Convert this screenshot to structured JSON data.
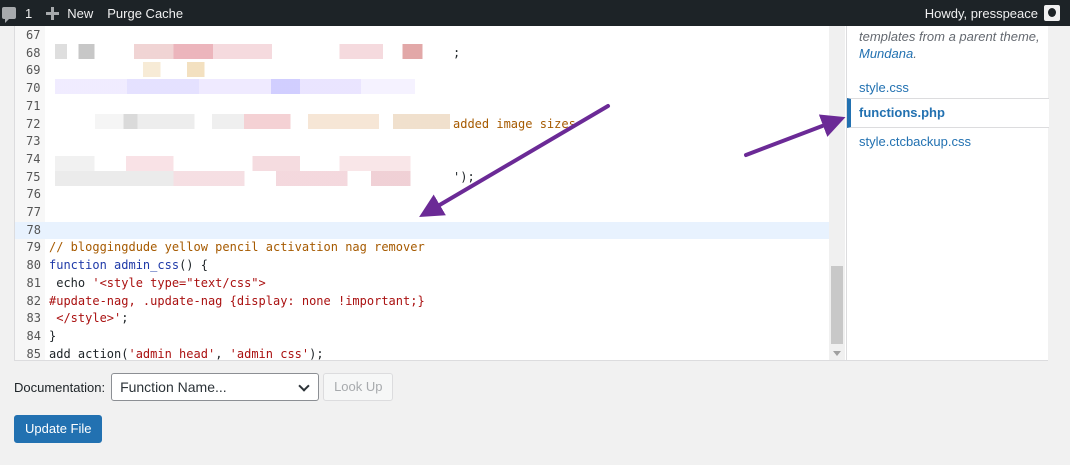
{
  "adminbar": {
    "comment_count": "1",
    "new_label": "New",
    "purge_label": "Purge Cache",
    "greeting": "Howdy, presspeace"
  },
  "editor": {
    "lines": [
      {
        "num": "67",
        "clipped": true,
        "parts": []
      },
      {
        "num": "68",
        "clipped": true,
        "parts": [
          {
            "cls": "c-text",
            "t": ";"
          }
        ]
      },
      {
        "num": "69",
        "clipped": true,
        "parts": []
      },
      {
        "num": "70",
        "clipped": true,
        "parts": []
      },
      {
        "num": "71",
        "clipped": true,
        "parts": []
      },
      {
        "num": "72",
        "clipped": true,
        "parts": [
          {
            "cls": "c-orange",
            "t": "added image sizes"
          }
        ]
      },
      {
        "num": "73",
        "clipped": true,
        "parts": []
      },
      {
        "num": "74",
        "clipped": true,
        "parts": []
      },
      {
        "num": "75",
        "clipped": true,
        "parts": [
          {
            "cls": "c-text",
            "t": "');"
          }
        ]
      },
      {
        "num": "76",
        "clipped": false,
        "parts": []
      },
      {
        "num": "77",
        "clipped": false,
        "parts": []
      },
      {
        "num": "78",
        "clipped": false,
        "parts": []
      },
      {
        "num": "79",
        "clipped": false,
        "parts": [
          {
            "cls": "c-comment",
            "t": "// bloggingdude yellow pencil activation nag remover"
          }
        ]
      },
      {
        "num": "80",
        "clipped": false,
        "parts": [
          {
            "cls": "c-kw",
            "t": "function "
          },
          {
            "cls": "c-kw",
            "t": "admin_css"
          },
          {
            "cls": "c-text",
            "t": "() {"
          }
        ]
      },
      {
        "num": "81",
        "clipped": false,
        "parts": [
          {
            "cls": "c-text",
            "t": " echo "
          },
          {
            "cls": "c-str",
            "t": "'<style type=\"text/css\">"
          }
        ]
      },
      {
        "num": "82",
        "clipped": false,
        "parts": [
          {
            "cls": "c-str",
            "t": "#update-nag, .update-nag {display: none !important;}"
          }
        ]
      },
      {
        "num": "83",
        "clipped": false,
        "parts": [
          {
            "cls": "c-str",
            "t": " </style>'"
          },
          {
            "cls": "c-text",
            "t": ";"
          }
        ]
      },
      {
        "num": "84",
        "clipped": false,
        "parts": [
          {
            "cls": "c-text",
            "t": "}"
          }
        ]
      },
      {
        "num": "85",
        "clipped": false,
        "parts": [
          {
            "cls": "c-text",
            "t": "add_action("
          },
          {
            "cls": "c-str",
            "t": "'admin_head'"
          },
          {
            "cls": "c-text",
            "t": ", "
          },
          {
            "cls": "c-str",
            "t": "'admin_css'"
          },
          {
            "cls": "c-text",
            "t": ");"
          }
        ]
      }
    ],
    "active_line": "78"
  },
  "files": {
    "description_prefix": "templates from a parent theme,",
    "parent_theme": "Mundana",
    "description_suffix": ".",
    "items": [
      {
        "label": "style.css",
        "current": false
      },
      {
        "label": "functions.php",
        "current": true
      },
      {
        "label": "style.ctcbackup.css",
        "current": false
      }
    ]
  },
  "documentation": {
    "label": "Documentation:",
    "select_value": "Function Name...",
    "lookup_label": "Look Up"
  },
  "update_button": "Update File",
  "colors": {
    "accent": "#2271b1",
    "annotation_arrow": "#6b2a96",
    "adminbar_bg": "#1d2327"
  }
}
